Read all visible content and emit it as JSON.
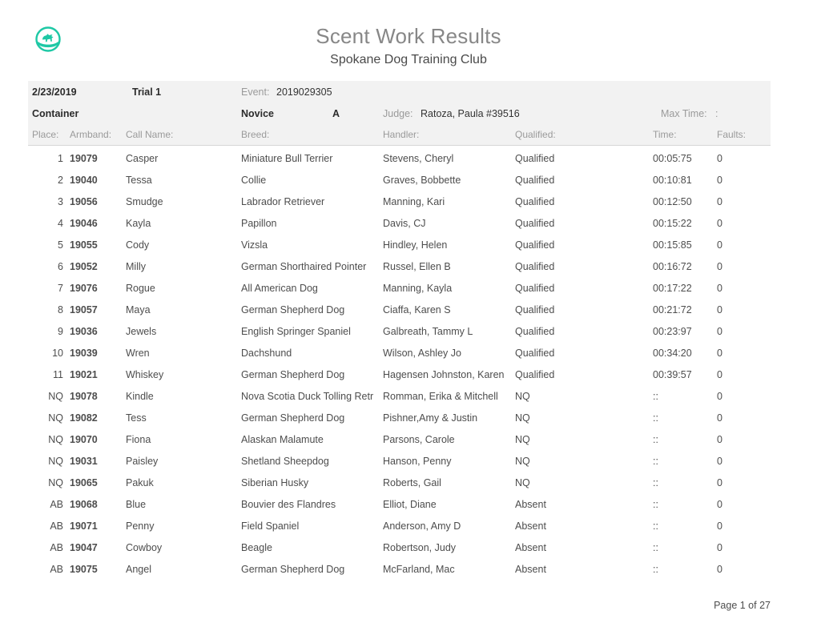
{
  "header": {
    "logo_icon": "dog-badge-icon",
    "logo_color": "#1ec8a5",
    "title": "Scent Work Results",
    "subtitle": "Spokane Dog Training Club"
  },
  "meta": {
    "date": "2/23/2019",
    "trial": "Trial 1",
    "event_label": "Event:",
    "event_value": "2019029305",
    "element": "Container",
    "class_level": "Novice",
    "section": "A",
    "judge_label": "Judge:",
    "judge_value": "Ratoza, Paula #39516",
    "max_time_label": "Max Time:",
    "max_time_value": ":"
  },
  "columns": {
    "place": "Place:",
    "armband": "Armband:",
    "call_name": "Call Name:",
    "breed": "Breed:",
    "handler": "Handler:",
    "qualified": "Qualified:",
    "time": "Time:",
    "faults": "Faults:"
  },
  "status_colors": {
    "qualified": "#34b94a",
    "nq": "#f03030",
    "absent": "#4d4d4d"
  },
  "rows": [
    {
      "place": "1",
      "armband": "19079",
      "call_name": "Casper",
      "breed": "Miniature Bull Terrier",
      "handler": "Stevens, Cheryl",
      "qualified": "Qualified",
      "status": "qualified",
      "time": "00:05:75",
      "faults": "0"
    },
    {
      "place": "2",
      "armband": "19040",
      "call_name": "Tessa",
      "breed": "Collie",
      "handler": "Graves, Bobbette",
      "qualified": "Qualified",
      "status": "qualified",
      "time": "00:10:81",
      "faults": "0"
    },
    {
      "place": "3",
      "armband": "19056",
      "call_name": "Smudge",
      "breed": "Labrador Retriever",
      "handler": "Manning, Kari",
      "qualified": "Qualified",
      "status": "qualified",
      "time": "00:12:50",
      "faults": "0"
    },
    {
      "place": "4",
      "armband": "19046",
      "call_name": "Kayla",
      "breed": "Papillon",
      "handler": "Davis, CJ",
      "qualified": "Qualified",
      "status": "qualified",
      "time": "00:15:22",
      "faults": "0"
    },
    {
      "place": "5",
      "armband": "19055",
      "call_name": "Cody",
      "breed": "Vizsla",
      "handler": "Hindley, Helen",
      "qualified": "Qualified",
      "status": "qualified",
      "time": "00:15:85",
      "faults": "0"
    },
    {
      "place": "6",
      "armband": "19052",
      "call_name": "Milly",
      "breed": "German Shorthaired Pointer",
      "handler": "Russel, Ellen B",
      "qualified": "Qualified",
      "status": "qualified",
      "time": "00:16:72",
      "faults": "0"
    },
    {
      "place": "7",
      "armband": "19076",
      "call_name": "Rogue",
      "breed": "All American Dog",
      "handler": "Manning, Kayla",
      "qualified": "Qualified",
      "status": "qualified",
      "time": "00:17:22",
      "faults": "0"
    },
    {
      "place": "8",
      "armband": "19057",
      "call_name": "Maya",
      "breed": "German Shepherd Dog",
      "handler": "Ciaffa, Karen S",
      "qualified": "Qualified",
      "status": "qualified",
      "time": "00:21:72",
      "faults": "0"
    },
    {
      "place": "9",
      "armband": "19036",
      "call_name": "Jewels",
      "breed": "English Springer Spaniel",
      "handler": "Galbreath, Tammy L",
      "qualified": "Qualified",
      "status": "qualified",
      "time": "00:23:97",
      "faults": "0"
    },
    {
      "place": "10",
      "armband": "19039",
      "call_name": "Wren",
      "breed": "Dachshund",
      "handler": "Wilson, Ashley Jo",
      "qualified": "Qualified",
      "status": "qualified",
      "time": "00:34:20",
      "faults": "0"
    },
    {
      "place": "11",
      "armband": "19021",
      "call_name": "Whiskey",
      "breed": "German Shepherd Dog",
      "handler": "Hagensen Johnston, Karen",
      "qualified": "Qualified",
      "status": "qualified",
      "time": "00:39:57",
      "faults": "0"
    },
    {
      "place": "NQ",
      "armband": "19078",
      "call_name": "Kindle",
      "breed": "Nova Scotia Duck Tolling Retr",
      "handler": "Romman, Erika & Mitchell",
      "qualified": "NQ",
      "status": "nq",
      "time": "::",
      "faults": "0"
    },
    {
      "place": "NQ",
      "armband": "19082",
      "call_name": "Tess",
      "breed": "German Shepherd Dog",
      "handler": "Pishner,Amy & Justin",
      "qualified": "NQ",
      "status": "nq",
      "time": "::",
      "faults": "0"
    },
    {
      "place": "NQ",
      "armband": "19070",
      "call_name": "Fiona",
      "breed": "Alaskan Malamute",
      "handler": "Parsons, Carole",
      "qualified": "NQ",
      "status": "nq",
      "time": "::",
      "faults": "0"
    },
    {
      "place": "NQ",
      "armband": "19031",
      "call_name": "Paisley",
      "breed": "Shetland Sheepdog",
      "handler": "Hanson, Penny",
      "qualified": "NQ",
      "status": "nq",
      "time": "::",
      "faults": "0"
    },
    {
      "place": "NQ",
      "armband": "19065",
      "call_name": "Pakuk",
      "breed": "Siberian Husky",
      "handler": "Roberts, Gail",
      "qualified": "NQ",
      "status": "nq",
      "time": "::",
      "faults": "0"
    },
    {
      "place": "AB",
      "armband": "19068",
      "call_name": "Blue",
      "breed": "Bouvier des Flandres",
      "handler": "Elliot, Diane",
      "qualified": "Absent",
      "status": "absent",
      "time": "::",
      "faults": "0"
    },
    {
      "place": "AB",
      "armband": "19071",
      "call_name": "Penny",
      "breed": "Field Spaniel",
      "handler": "Anderson, Amy D",
      "qualified": "Absent",
      "status": "absent",
      "time": "::",
      "faults": "0"
    },
    {
      "place": "AB",
      "armband": "19047",
      "call_name": "Cowboy",
      "breed": "Beagle",
      "handler": "Robertson, Judy",
      "qualified": "Absent",
      "status": "absent",
      "time": "::",
      "faults": "0"
    },
    {
      "place": "AB",
      "armband": "19075",
      "call_name": "Angel",
      "breed": "German Shepherd Dog",
      "handler": "McFarland, Mac",
      "qualified": "Absent",
      "status": "absent",
      "time": "::",
      "faults": "0"
    }
  ],
  "footer": {
    "page_label": "Page 1 of 27"
  }
}
